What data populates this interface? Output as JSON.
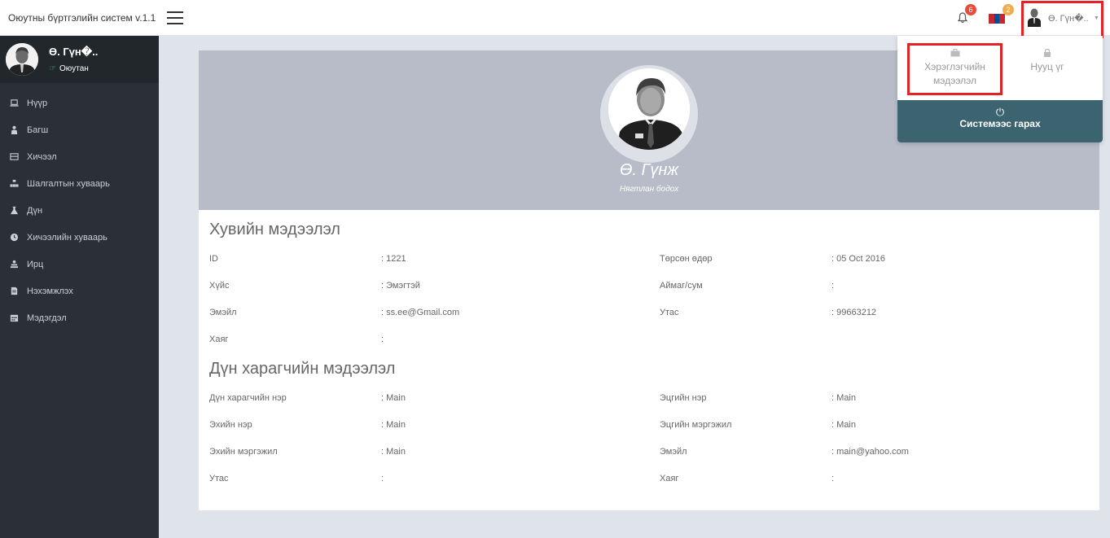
{
  "topbar": {
    "brand": "Оюутны бүртгэлийн систем v.1.1",
    "notifications_count": "6",
    "messages_count": "2",
    "user_short": "Ө. Гүн�..",
    "flag_colors": [
      "#c4272f",
      "#015197",
      "#c4272f"
    ]
  },
  "sidebar": {
    "name": "Ө. Гүн�..",
    "role": "Оюутан",
    "items": [
      {
        "label": "Нүүр",
        "icon": "laptop-icon"
      },
      {
        "label": "Багш",
        "icon": "teacher-icon"
      },
      {
        "label": "Хичээл",
        "icon": "book-icon"
      },
      {
        "label": "Шалгалтын хуваарь",
        "icon": "sitemap-icon"
      },
      {
        "label": "Дүн",
        "icon": "flask-icon"
      },
      {
        "label": "Хичээлийн хуваарь",
        "icon": "clock-icon"
      },
      {
        "label": "Ирц",
        "icon": "users-icon"
      },
      {
        "label": "Нэхэмжлэх",
        "icon": "file-icon"
      },
      {
        "label": "Мэдэгдэл",
        "icon": "calendar-icon"
      }
    ]
  },
  "profile": {
    "name": "Ө. Гүнж",
    "subtitle": "Нягтлан бодох"
  },
  "personal": {
    "title": "Хувийн мэдээлэл",
    "rows": [
      {
        "label": "ID",
        "value": ": 1221",
        "label2": "Төрсөн өдөр",
        "value2": ": 05 Oct 2016"
      },
      {
        "label": "Хүйс",
        "value": ": Эмэгтэй",
        "label2": "Аймаг/сум",
        "value2": ":"
      },
      {
        "label": "Эмэйл",
        "value": ": ss.ee@Gmail.com",
        "label2": "Утас",
        "value2": ": 99663212"
      },
      {
        "label": "Хаяг",
        "value": ":",
        "label2": "",
        "value2": ""
      }
    ]
  },
  "guardian": {
    "title": "Дүн харагчийн мэдээлэл",
    "rows": [
      {
        "label": "Дүн харагчийн нэр",
        "value": ": Main",
        "label2": "Эцгийн нэр",
        "value2": ": Main"
      },
      {
        "label": "Эхийн нэр",
        "value": ": Main",
        "label2": "Эцгийн мэргэжил",
        "value2": ": Main"
      },
      {
        "label": "Эхийн мэргэжил",
        "value": ": Main",
        "label2": "Эмэйл",
        "value2": ": main@yahoo.com"
      },
      {
        "label": "Утас",
        "value": ":",
        "label2": "Хаяг",
        "value2": ":"
      }
    ]
  },
  "dropdown": {
    "user_info_line1": "Хэрэглэгчийн",
    "user_info_line2": "мэдээлэл",
    "password": "Нууц үг",
    "logout": "Системээс гарах"
  }
}
